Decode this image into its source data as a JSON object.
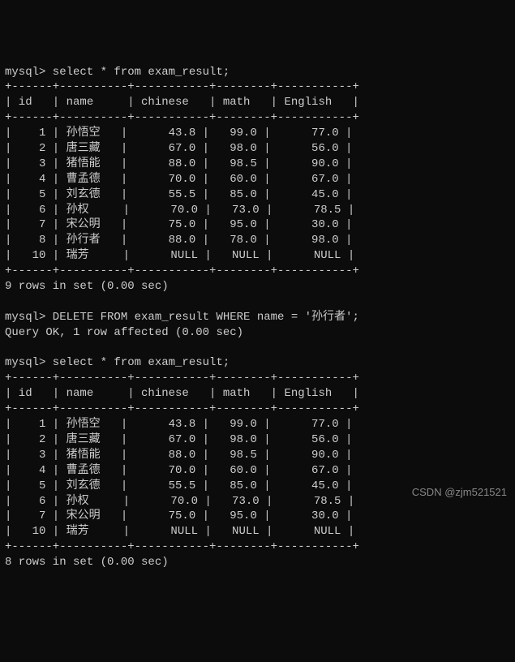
{
  "prompt": "mysql>",
  "queries": {
    "select": "select * from exam_result;",
    "delete": "DELETE FROM exam_result WHERE name = '孙行者';",
    "deleteResponse": "Query OK, 1 row affected (0.00 sec)"
  },
  "headers": {
    "id": "id",
    "name": "name",
    "chinese": "chinese",
    "math": "math",
    "english": "English"
  },
  "table1": {
    "rows": [
      {
        "id": "1",
        "name": "孙悟空",
        "chinese": "43.8",
        "math": "99.0",
        "english": "77.0"
      },
      {
        "id": "2",
        "name": "唐三藏",
        "chinese": "67.0",
        "math": "98.0",
        "english": "56.0"
      },
      {
        "id": "3",
        "name": "猪悟能",
        "chinese": "88.0",
        "math": "98.5",
        "english": "90.0"
      },
      {
        "id": "4",
        "name": "曹孟德",
        "chinese": "70.0",
        "math": "60.0",
        "english": "67.0"
      },
      {
        "id": "5",
        "name": "刘玄德",
        "chinese": "55.5",
        "math": "85.0",
        "english": "45.0"
      },
      {
        "id": "6",
        "name": "孙权",
        "chinese": "70.0",
        "math": "73.0",
        "english": "78.5"
      },
      {
        "id": "7",
        "name": "宋公明",
        "chinese": "75.0",
        "math": "95.0",
        "english": "30.0"
      },
      {
        "id": "8",
        "name": "孙行者",
        "chinese": "88.0",
        "math": "78.0",
        "english": "98.0"
      },
      {
        "id": "10",
        "name": "瑞芳",
        "chinese": "NULL",
        "math": "NULL",
        "english": "NULL"
      }
    ],
    "footer": "9 rows in set (0.00 sec)"
  },
  "table2": {
    "rows": [
      {
        "id": "1",
        "name": "孙悟空",
        "chinese": "43.8",
        "math": "99.0",
        "english": "77.0"
      },
      {
        "id": "2",
        "name": "唐三藏",
        "chinese": "67.0",
        "math": "98.0",
        "english": "56.0"
      },
      {
        "id": "3",
        "name": "猪悟能",
        "chinese": "88.0",
        "math": "98.5",
        "english": "90.0"
      },
      {
        "id": "4",
        "name": "曹孟德",
        "chinese": "70.0",
        "math": "60.0",
        "english": "67.0"
      },
      {
        "id": "5",
        "name": "刘玄德",
        "chinese": "55.5",
        "math": "85.0",
        "english": "45.0"
      },
      {
        "id": "6",
        "name": "孙权",
        "chinese": "70.0",
        "math": "73.0",
        "english": "78.5"
      },
      {
        "id": "7",
        "name": "宋公明",
        "chinese": "75.0",
        "math": "95.0",
        "english": "30.0"
      },
      {
        "id": "10",
        "name": "瑞芳",
        "chinese": "NULL",
        "math": "NULL",
        "english": "NULL"
      }
    ],
    "footer": "8 rows in set (0.00 sec)"
  },
  "watermark": "CSDN @zjm521521"
}
